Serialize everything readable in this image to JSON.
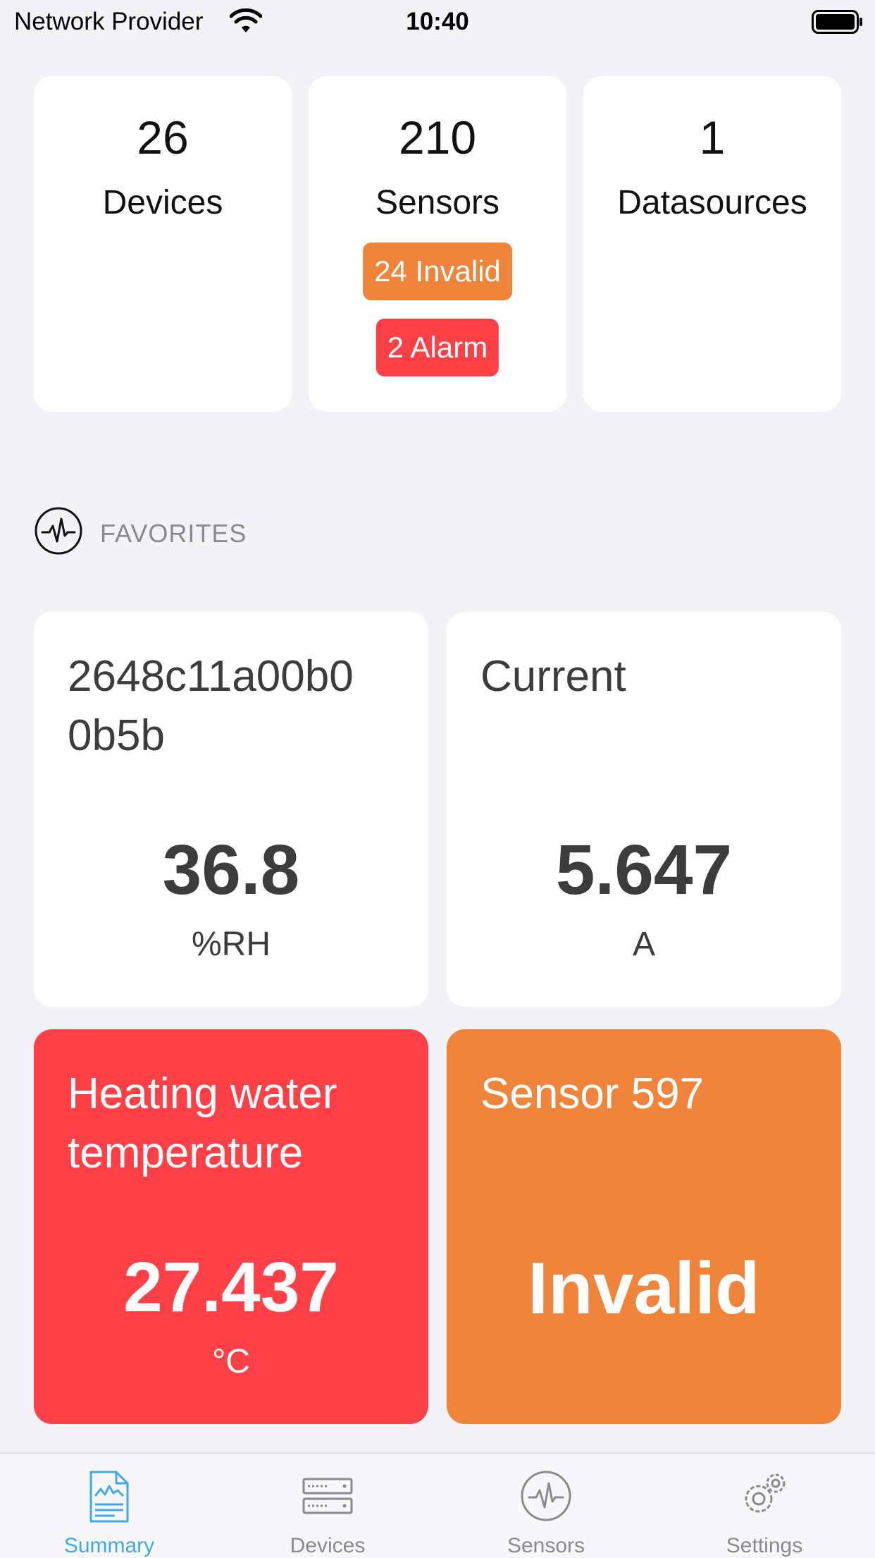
{
  "status_bar": {
    "carrier": "Network Provider",
    "time": "10:40"
  },
  "summary": [
    {
      "count": "26",
      "label": "Devices"
    },
    {
      "count": "210",
      "label": "Sensors",
      "invalid_badge": "24 Invalid",
      "alarm_badge": "2 Alarm"
    },
    {
      "count": "1",
      "label": "Datasources"
    }
  ],
  "favorites": {
    "title": "FAVORITES",
    "cards": [
      {
        "name": "2648c11a00b0\n0b5b",
        "value": "36.8",
        "unit": "%RH",
        "state": "normal"
      },
      {
        "name": "Current",
        "value": "5.647",
        "unit": "A",
        "state": "normal"
      },
      {
        "name": "Heating water temperature",
        "value": "27.437",
        "unit": "°C",
        "state": "alarm"
      },
      {
        "name": "Sensor 597",
        "value": "Invalid",
        "unit": "",
        "state": "invalid"
      }
    ]
  },
  "tab_bar": {
    "tabs": [
      {
        "label": "Summary",
        "icon": "document-chart-icon",
        "active": true
      },
      {
        "label": "Devices",
        "icon": "server-rack-icon",
        "active": false
      },
      {
        "label": "Sensors",
        "icon": "pulse-circle-icon",
        "active": false
      },
      {
        "label": "Settings",
        "icon": "gears-icon",
        "active": false
      }
    ]
  },
  "colors": {
    "background": "#f2f2f7",
    "invalid": "#ef843a",
    "alarm": "#ff4046",
    "active_tab": "#3fa8e8",
    "inactive_tab": "#8a8a8e"
  }
}
